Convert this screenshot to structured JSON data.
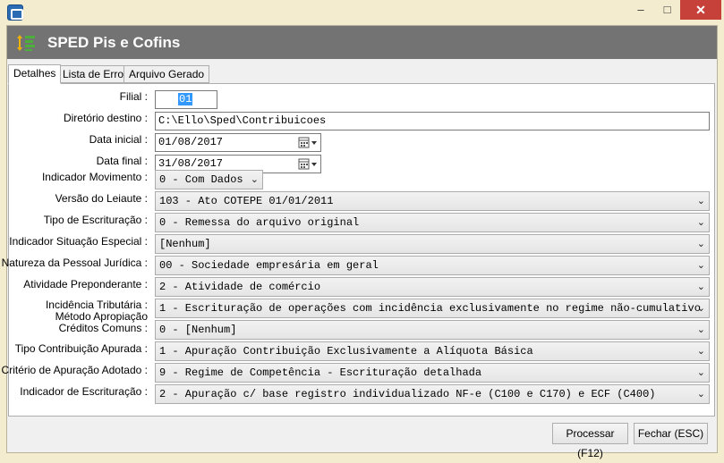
{
  "window": {
    "minimize": "‒",
    "maximize": "□",
    "close": "✕"
  },
  "header": {
    "title": "SPED Pis e Cofins",
    "icon": "list-sort-icon"
  },
  "tabs": [
    "Detalhes",
    "Lista de Erro",
    "Arquivo Gerado"
  ],
  "form": {
    "filial": {
      "label": "Filial :",
      "value": "01"
    },
    "diretorio": {
      "label": "Diretório destino :",
      "value": "C:\\Ello\\Sped\\Contribuicoes"
    },
    "data_inicial": {
      "label": "Data inicial :",
      "value": "01/08/2017"
    },
    "data_final": {
      "label": "Data final :",
      "value": "31/08/2017"
    },
    "indicador_movimento": {
      "label": "Indicador Movimento :",
      "value": "0 - Com Dados"
    },
    "versao_leiaute": {
      "label": "Versão do Leiaute :",
      "value": "103 - Ato COTEPE 01/01/2011"
    },
    "tipo_escrituracao": {
      "label": "Tipo de Escrituração :",
      "value": "0 - Remessa do arquivo original"
    },
    "indicador_situacao": {
      "label": "Indicador Situação Especial :",
      "value": "[Nenhum]"
    },
    "natureza_pj": {
      "label": "Natureza da Pessoal Jurídica :",
      "value": "00 - Sociedade empresária em geral"
    },
    "atividade": {
      "label": "Atividade Preponderante :",
      "value": "2 - Atividade de comércio"
    },
    "incidencia": {
      "label": "Incidência Tributária :",
      "value": "1 - Escrituração de operações com incidência exclusivamente no regime não-cumulativo"
    },
    "metodo_label_1": "Método Apropiação",
    "metodo_label_2": "Créditos Comuns :",
    "metodo": {
      "value": "0 - [Nenhum]"
    },
    "tipo_contribuicao": {
      "label": "Tipo Contribuição Apurada :",
      "value": "1 - Apuração Contribuição Exclusivamente a Alíquota Básica"
    },
    "criterio": {
      "label": "Critério de Apuração Adotado :",
      "value": "9 - Regime de Competência - Escrituração detalhada"
    },
    "indicador_escrituracao": {
      "label": "Indicador de Escrituração :",
      "value": "2 - Apuração c/ base registro individualizado NF-e (C100 e C170) e ECF (C400)"
    }
  },
  "buttons": {
    "processar": "Processar (F12)",
    "fechar": "Fechar (ESC)"
  }
}
